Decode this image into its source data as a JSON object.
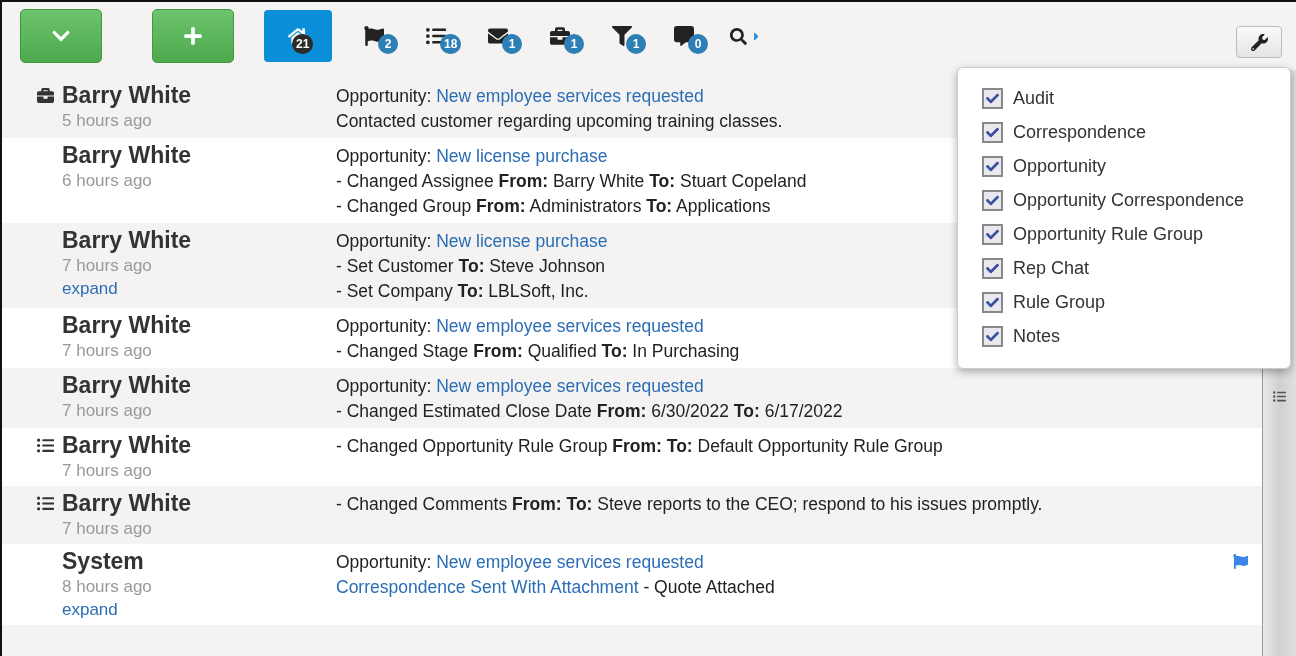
{
  "toolbar": {
    "buttons": [
      {
        "kind": "collapse"
      },
      {
        "kind": "add"
      }
    ],
    "tabs": [
      {
        "kind": "home",
        "count": "21",
        "selected": true
      },
      {
        "kind": "flag",
        "count": "2",
        "selected": false
      },
      {
        "kind": "list",
        "count": "18",
        "selected": false
      },
      {
        "kind": "mail",
        "count": "1",
        "selected": false
      },
      {
        "kind": "briefcase",
        "count": "1",
        "selected": false
      },
      {
        "kind": "filter",
        "count": "1",
        "selected": false
      },
      {
        "kind": "chat",
        "count": "0",
        "selected": false
      }
    ]
  },
  "feed": [
    {
      "kind": "opportunity",
      "name": "Barry White",
      "time": "5 hours ago",
      "lines": [
        [
          {
            "kind": "text",
            "text": "Opportunity: "
          },
          {
            "kind": "link",
            "text": "New employee services requested"
          }
        ],
        [
          {
            "kind": "text",
            "text": "Contacted customer regarding upcoming training classes."
          }
        ]
      ]
    },
    {
      "name": "Barry White",
      "time": "6 hours ago",
      "lines": [
        [
          {
            "kind": "text",
            "text": "Opportunity: "
          },
          {
            "kind": "link",
            "text": "New license purchase"
          }
        ],
        [
          {
            "kind": "text",
            "text": "- Changed Assignee **From:** Barry White **To:** Stuart Copeland"
          }
        ],
        [
          {
            "kind": "text",
            "text": "- Changed Group **From:** Administrators **To:** Applications"
          }
        ]
      ]
    },
    {
      "name": "Barry White",
      "time": "7 hours ago",
      "expand": "expand",
      "lines": [
        [
          {
            "kind": "text",
            "text": "Opportunity: "
          },
          {
            "kind": "link",
            "text": "New license purchase"
          }
        ],
        [
          {
            "kind": "text",
            "text": "- Set Customer **To:** Steve Johnson"
          }
        ],
        [
          {
            "kind": "text",
            "text": "- Set Company **To:** LBLSoft, Inc."
          }
        ]
      ]
    },
    {
      "name": "Barry White",
      "time": "7 hours ago",
      "lines": [
        [
          {
            "kind": "text",
            "text": "Opportunity: "
          },
          {
            "kind": "link",
            "text": "New employee services requested"
          }
        ],
        [
          {
            "kind": "text",
            "text": "- Changed Stage **From:** Qualified **To:** In Purchasing"
          }
        ]
      ]
    },
    {
      "name": "Barry White",
      "time": "7 hours ago",
      "lines": [
        [
          {
            "kind": "text",
            "text": "Opportunity: "
          },
          {
            "kind": "link",
            "text": "New employee services requested"
          }
        ],
        [
          {
            "kind": "text",
            "text": "- Changed Estimated Close Date **From:** 6/30/2022 **To:** 6/17/2022"
          }
        ]
      ]
    },
    {
      "kind": "rule_group",
      "name": "Barry White",
      "time": "7 hours ago",
      "lines": [
        [
          {
            "kind": "text",
            "text": "- Changed Opportunity Rule Group **From:** **To:** Default Opportunity Rule Group"
          }
        ]
      ]
    },
    {
      "kind": "rule_group",
      "name": "Barry White",
      "time": "7 hours ago",
      "lines": [
        [
          {
            "kind": "text",
            "text": "- Changed Comments **From:** **To:** Steve reports to the CEO; respond to his issues promptly."
          }
        ]
      ]
    },
    {
      "name": "System",
      "time": "8 hours ago",
      "expand": "expand",
      "flagged": true,
      "lines": [
        [
          {
            "kind": "text",
            "text": "Opportunity: "
          },
          {
            "kind": "link",
            "text": "New employee services requested"
          }
        ],
        [
          {
            "kind": "link",
            "text": "Correspondence Sent With Attachment"
          },
          {
            "kind": "text",
            "text": " - Quote Attached"
          }
        ]
      ]
    }
  ],
  "filter_menu": {
    "items": [
      {
        "label": "Audit",
        "checked": true
      },
      {
        "label": "Correspondence",
        "checked": true
      },
      {
        "label": "Opportunity",
        "checked": true
      },
      {
        "label": "Opportunity Correspondence",
        "checked": true
      },
      {
        "label": "Opportunity Rule Group",
        "checked": true
      },
      {
        "label": "Rep Chat",
        "checked": true
      },
      {
        "label": "Rule Group",
        "checked": true
      },
      {
        "label": "Notes",
        "checked": true
      }
    ]
  }
}
